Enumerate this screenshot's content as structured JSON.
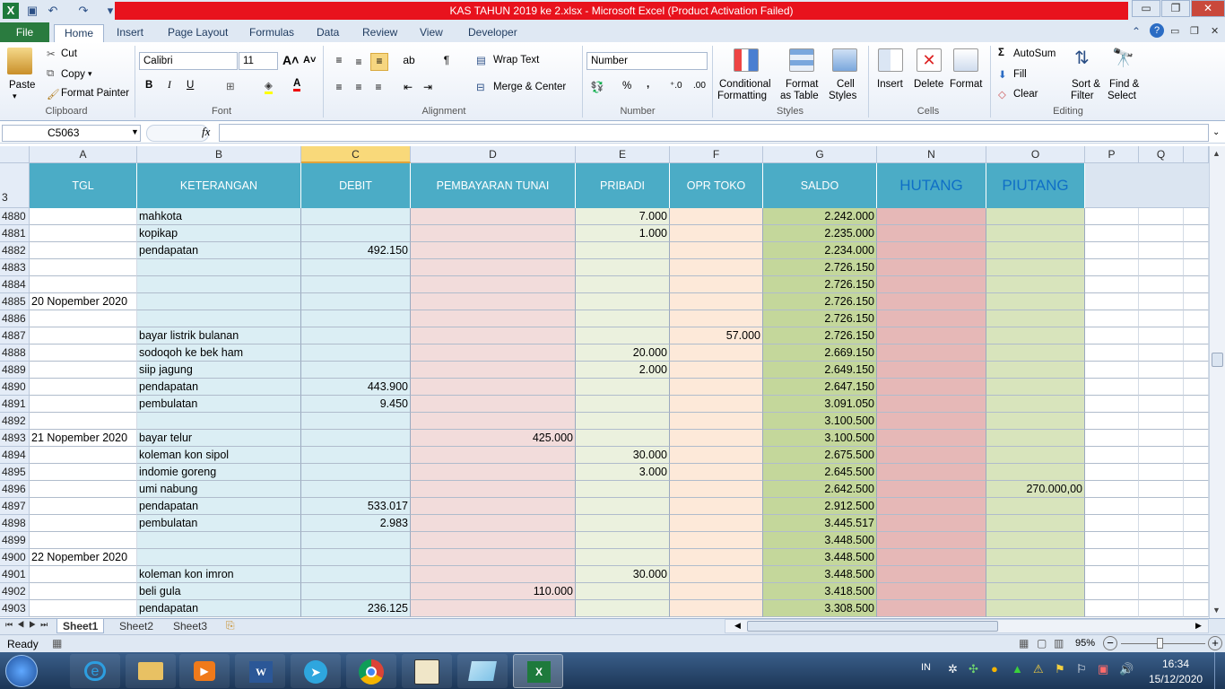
{
  "window": {
    "title": "KAS TAHUN 2019 ke 2.xlsx  -  Microsoft Excel (Product Activation Failed)",
    "minimize": "▭",
    "restore": "❐",
    "close": "✕"
  },
  "ribbon_tabs": [
    "File",
    "Home",
    "Insert",
    "Page Layout",
    "Formulas",
    "Data",
    "Review",
    "View",
    "Developer"
  ],
  "clipboard": {
    "paste": "Paste",
    "cut": "Cut",
    "copy": "Copy",
    "format_painter": "Format Painter",
    "label": "Clipboard"
  },
  "font": {
    "name": "Calibri",
    "size": "11",
    "bold": "B",
    "italic": "I",
    "underline": "U",
    "label": "Font"
  },
  "alignment": {
    "wrap": "Wrap Text",
    "merge": "Merge & Center",
    "label": "Alignment"
  },
  "number": {
    "format": "Number",
    "percent": "%",
    "comma": ",",
    "label": "Number"
  },
  "styles": {
    "conditional": "Conditional",
    "conditional2": "Formatting",
    "format_table": "Format",
    "format_table2": "as Table",
    "cell_styles": "Cell",
    "cell_styles2": "Styles",
    "label": "Styles"
  },
  "cells": {
    "insert": "Insert",
    "delete": "Delete",
    "format": "Format",
    "label": "Cells"
  },
  "editing": {
    "autosum": "AutoSum",
    "fill": "Fill",
    "clear": "Clear",
    "sort": "Sort &",
    "sort2": "Filter",
    "find": "Find &",
    "find2": "Select",
    "label": "Editing"
  },
  "formula_bar": {
    "name_box": "C5063",
    "fx": "fx",
    "value": ""
  },
  "columns": [
    "A",
    "B",
    "C",
    "D",
    "E",
    "F",
    "G",
    "N",
    "O",
    "P",
    "Q"
  ],
  "header_row": {
    "num": "3",
    "tgl": "TGL",
    "keterangan": "KETERANGAN",
    "debit": "DEBIT",
    "pembayaran": "PEMBAYARAN TUNAI",
    "pribadi": "PRIBADI",
    "opr": "OPR TOKO",
    "saldo": "SALDO",
    "hutang": "HUTANG",
    "piutang": "PIUTANG"
  },
  "rows": [
    {
      "n": "4880",
      "tgl": "",
      "ket": "mahkota",
      "debit": "",
      "bayar": "",
      "pribadi": "7.000",
      "opr": "",
      "saldo": "2.242.000",
      "piutang": ""
    },
    {
      "n": "4881",
      "tgl": "",
      "ket": "kopikap",
      "debit": "",
      "bayar": "",
      "pribadi": "1.000",
      "opr": "",
      "saldo": "2.235.000",
      "piutang": ""
    },
    {
      "n": "4882",
      "tgl": "",
      "ket": "pendapatan",
      "debit": "492.150",
      "bayar": "",
      "pribadi": "",
      "opr": "",
      "saldo": "2.234.000",
      "piutang": ""
    },
    {
      "n": "4883",
      "tgl": "",
      "ket": "",
      "debit": "",
      "bayar": "",
      "pribadi": "",
      "opr": "",
      "saldo": "2.726.150",
      "piutang": ""
    },
    {
      "n": "4884",
      "tgl": "",
      "ket": "",
      "debit": "",
      "bayar": "",
      "pribadi": "",
      "opr": "",
      "saldo": "2.726.150",
      "piutang": ""
    },
    {
      "n": "4885",
      "tgl": "20 Nopember 2020",
      "ket": "",
      "debit": "",
      "bayar": "",
      "pribadi": "",
      "opr": "",
      "saldo": "2.726.150",
      "piutang": ""
    },
    {
      "n": "4886",
      "tgl": "",
      "ket": "",
      "debit": "",
      "bayar": "",
      "pribadi": "",
      "opr": "",
      "saldo": "2.726.150",
      "piutang": ""
    },
    {
      "n": "4887",
      "tgl": "",
      "ket": "bayar listrik bulanan",
      "debit": "",
      "bayar": "",
      "pribadi": "",
      "opr": "57.000",
      "saldo": "2.726.150",
      "piutang": ""
    },
    {
      "n": "4888",
      "tgl": "",
      "ket": "sodoqoh ke bek ham",
      "debit": "",
      "bayar": "",
      "pribadi": "20.000",
      "opr": "",
      "saldo": "2.669.150",
      "piutang": ""
    },
    {
      "n": "4889",
      "tgl": "",
      "ket": "siip jagung",
      "debit": "",
      "bayar": "",
      "pribadi": "2.000",
      "opr": "",
      "saldo": "2.649.150",
      "piutang": ""
    },
    {
      "n": "4890",
      "tgl": "",
      "ket": "pendapatan",
      "debit": "443.900",
      "bayar": "",
      "pribadi": "",
      "opr": "",
      "saldo": "2.647.150",
      "piutang": ""
    },
    {
      "n": "4891",
      "tgl": "",
      "ket": "pembulatan",
      "debit": "9.450",
      "bayar": "",
      "pribadi": "",
      "opr": "",
      "saldo": "3.091.050",
      "piutang": ""
    },
    {
      "n": "4892",
      "tgl": "",
      "ket": "",
      "debit": "",
      "bayar": "",
      "pribadi": "",
      "opr": "",
      "saldo": "3.100.500",
      "piutang": ""
    },
    {
      "n": "4893",
      "tgl": "21 Nopember 2020",
      "ket": "bayar telur",
      "debit": "",
      "bayar": "425.000",
      "pribadi": "",
      "opr": "",
      "saldo": "3.100.500",
      "piutang": ""
    },
    {
      "n": "4894",
      "tgl": "",
      "ket": "koleman kon sipol",
      "debit": "",
      "bayar": "",
      "pribadi": "30.000",
      "opr": "",
      "saldo": "2.675.500",
      "piutang": ""
    },
    {
      "n": "4895",
      "tgl": "",
      "ket": "indomie goreng",
      "debit": "",
      "bayar": "",
      "pribadi": "3.000",
      "opr": "",
      "saldo": "2.645.500",
      "piutang": ""
    },
    {
      "n": "4896",
      "tgl": "",
      "ket": "umi nabung",
      "debit": "",
      "bayar": "",
      "pribadi": "",
      "opr": "",
      "saldo": "2.642.500",
      "piutang": "270.000,00"
    },
    {
      "n": "4897",
      "tgl": "",
      "ket": "pendapatan",
      "debit": "533.017",
      "bayar": "",
      "pribadi": "",
      "opr": "",
      "saldo": "2.912.500",
      "piutang": ""
    },
    {
      "n": "4898",
      "tgl": "",
      "ket": "pembulatan",
      "debit": "2.983",
      "bayar": "",
      "pribadi": "",
      "opr": "",
      "saldo": "3.445.517",
      "piutang": ""
    },
    {
      "n": "4899",
      "tgl": "",
      "ket": "",
      "debit": "",
      "bayar": "",
      "pribadi": "",
      "opr": "",
      "saldo": "3.448.500",
      "piutang": ""
    },
    {
      "n": "4900",
      "tgl": "22 Nopember 2020",
      "ket": "",
      "debit": "",
      "bayar": "",
      "pribadi": "",
      "opr": "",
      "saldo": "3.448.500",
      "piutang": ""
    },
    {
      "n": "4901",
      "tgl": "",
      "ket": "koleman kon imron",
      "debit": "",
      "bayar": "",
      "pribadi": "30.000",
      "opr": "",
      "saldo": "3.448.500",
      "piutang": ""
    },
    {
      "n": "4902",
      "tgl": "",
      "ket": "beli gula",
      "debit": "",
      "bayar": "110.000",
      "pribadi": "",
      "opr": "",
      "saldo": "3.418.500",
      "piutang": ""
    },
    {
      "n": "4903",
      "tgl": "",
      "ket": "pendapatan",
      "debit": "236.125",
      "bayar": "",
      "pribadi": "",
      "opr": "",
      "saldo": "3.308.500",
      "piutang": ""
    }
  ],
  "sheets": [
    "Sheet1",
    "Sheet2",
    "Sheet3"
  ],
  "status": {
    "ready": "Ready",
    "zoom": "95%",
    "minus": "−",
    "plus": "+"
  },
  "taskbar": {
    "lang": "IN",
    "time": "16:34",
    "date": "15/12/2020"
  },
  "colors": {
    "header_bg": "#4bacc6",
    "col_a": "#ffffff",
    "col_bc": "#dbeef4",
    "col_d": "#f2dcdb",
    "col_e": "#ebf1de",
    "col_f": "#fde9d9",
    "col_g": "#c4d79b",
    "col_n": "#e6b8b7",
    "col_o": "#d8e4bc",
    "title_red": "#e8121d"
  }
}
